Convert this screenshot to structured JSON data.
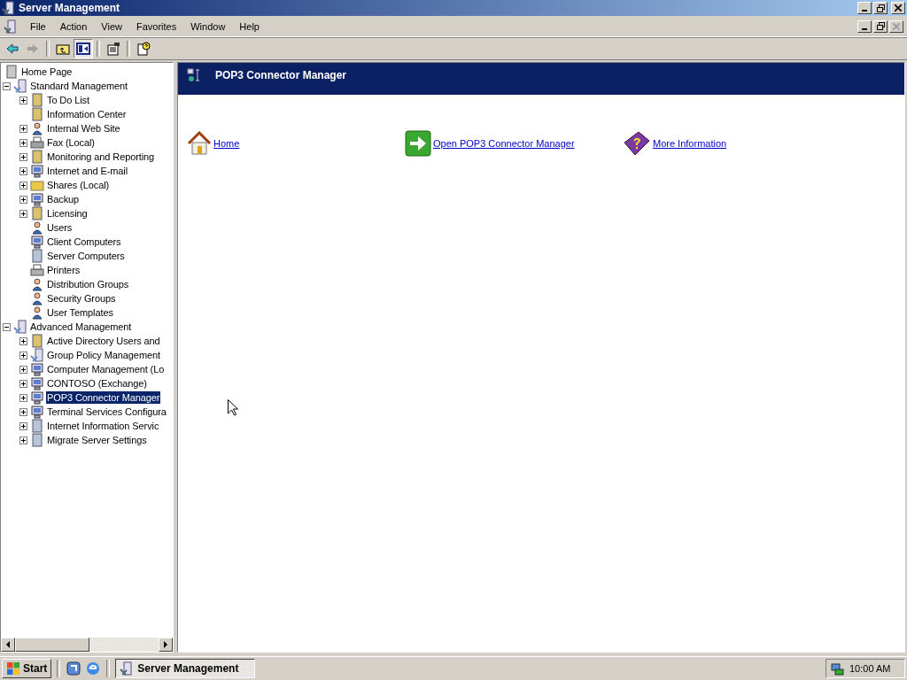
{
  "window": {
    "title": "Server Management"
  },
  "menu": [
    {
      "label": "File"
    },
    {
      "label": "Action"
    },
    {
      "label": "View"
    },
    {
      "label": "Favorites"
    },
    {
      "label": "Window"
    },
    {
      "label": "Help"
    }
  ],
  "toolbar": [
    {
      "kind": "back",
      "disabled": false
    },
    {
      "kind": "forward",
      "disabled": true
    },
    {
      "kind": "sep"
    },
    {
      "kind": "up",
      "disabled": false
    },
    {
      "kind": "tree",
      "disabled": false
    },
    {
      "kind": "sep"
    },
    {
      "kind": "properties",
      "disabled": false
    },
    {
      "kind": "sep"
    },
    {
      "kind": "help",
      "disabled": false
    }
  ],
  "tree": [
    {
      "label": "Home Page",
      "selected": false
    },
    {
      "label": "Standard Management",
      "expanded": true,
      "selected": false,
      "children": [
        {
          "label": "To Do List",
          "expanded": false,
          "selected": false
        },
        {
          "label": "Information Center",
          "selected": false
        },
        {
          "label": "Internal Web Site",
          "expanded": false,
          "selected": false
        },
        {
          "label": "Fax (Local)",
          "expanded": false,
          "selected": false
        },
        {
          "label": "Monitoring and Reporting",
          "expanded": false,
          "selected": false
        },
        {
          "label": "Internet and E-mail",
          "expanded": false,
          "selected": false
        },
        {
          "label": "Shares (Local)",
          "expanded": false,
          "selected": false
        },
        {
          "label": "Backup",
          "expanded": false,
          "selected": false
        },
        {
          "label": "Licensing",
          "expanded": false,
          "selected": false
        },
        {
          "label": "Users",
          "selected": false
        },
        {
          "label": "Client Computers",
          "selected": false
        },
        {
          "label": "Server Computers",
          "selected": false
        },
        {
          "label": "Printers",
          "selected": false
        },
        {
          "label": "Distribution Groups",
          "selected": false
        },
        {
          "label": "Security Groups",
          "selected": false
        },
        {
          "label": "User Templates",
          "selected": false
        }
      ]
    },
    {
      "label": "Advanced Management",
      "expanded": true,
      "selected": false,
      "children": [
        {
          "label": "Active Directory Users and",
          "expanded": false,
          "selected": false
        },
        {
          "label": "Group Policy Management",
          "expanded": false,
          "selected": false
        },
        {
          "label": "Computer Management (Lo",
          "expanded": false,
          "selected": false
        },
        {
          "label": "CONTOSO (Exchange)",
          "expanded": false,
          "selected": false
        },
        {
          "label": "POP3 Connector Manager",
          "expanded": false,
          "selected": true
        },
        {
          "label": "Terminal Services Configura",
          "expanded": false,
          "selected": false
        },
        {
          "label": "Internet Information Servic",
          "expanded": false,
          "selected": false
        },
        {
          "label": "Migrate Server Settings",
          "expanded": false,
          "selected": false
        }
      ]
    }
  ],
  "content": {
    "header": "POP3 Connector Manager",
    "links": [
      {
        "kind": "home",
        "label": "Home"
      },
      {
        "kind": "open",
        "label": "Open POP3 Connector Manager"
      },
      {
        "kind": "info",
        "label": "More Information"
      }
    ]
  },
  "taskbar": {
    "start": "Start",
    "quick_launch": [
      {
        "kind": "manage"
      },
      {
        "kind": "browser"
      }
    ],
    "tasks": [
      {
        "label": "Server Management",
        "selected": true
      }
    ],
    "clock": "10:00 AM"
  }
}
